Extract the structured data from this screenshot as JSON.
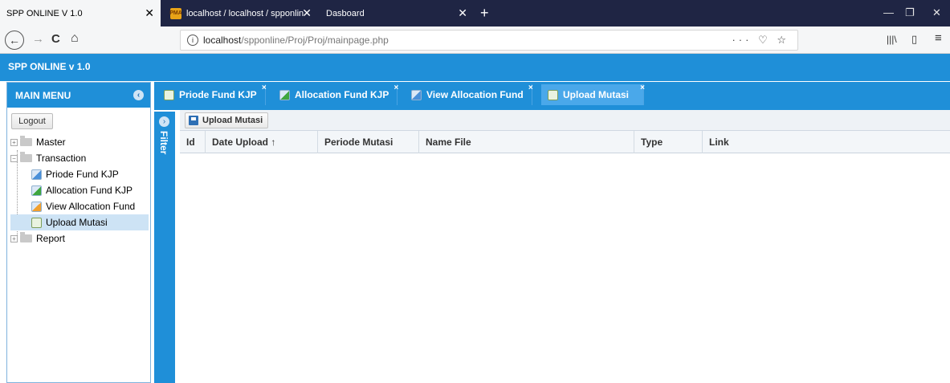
{
  "browser": {
    "tabs": [
      {
        "title": "SPP ONLINE V 1.0",
        "close": "✕"
      },
      {
        "title": "localhost / localhost / spponlin",
        "close": "✕",
        "favicon": "PMA"
      },
      {
        "title": "Dasboard",
        "close": "✕"
      }
    ],
    "new_tab": "+",
    "window_controls": {
      "minimize": "—",
      "restore": "❐",
      "close": "✕"
    }
  },
  "navbar": {
    "back": "←",
    "forward": "→",
    "reload": "C",
    "home": "⌂",
    "url_info": "i",
    "url_host": "localhost",
    "url_path": "/spponline/Proj/Proj/mainpage.php",
    "url_actions": "··· ♡ ☆",
    "library": "|||\\",
    "sidebar_toggle": "▯",
    "menu": "≡"
  },
  "app": {
    "title": "SPP ONLINE v 1.0"
  },
  "sidebar": {
    "title": "MAIN MENU",
    "logout": "Logout",
    "tree": [
      {
        "label": "Master",
        "type": "folder",
        "expander": "+"
      },
      {
        "label": "Transaction",
        "type": "folder",
        "expander": "−"
      },
      {
        "label": "Priode Fund KJP",
        "type": "leaf",
        "icon": "blue"
      },
      {
        "label": "Allocation Fund KJP",
        "type": "leaf",
        "icon": "green"
      },
      {
        "label": "View Allocation Fund",
        "type": "leaf",
        "icon": "orange"
      },
      {
        "label": "Upload Mutasi",
        "type": "leaf",
        "icon": "sheet",
        "selected": true
      },
      {
        "label": "Report",
        "type": "folder",
        "expander": "+"
      }
    ]
  },
  "filter": {
    "label": "Filter",
    "expand": "›"
  },
  "tabs": [
    {
      "label": "Priode Fund KJP",
      "close": "×"
    },
    {
      "label": "Allocation Fund KJP",
      "close": "×"
    },
    {
      "label": "View Allocation Fund",
      "close": "×"
    },
    {
      "label": "Upload Mutasi",
      "close": "×",
      "active": true
    }
  ],
  "toolbar": {
    "upload_label": "Upload Mutasi"
  },
  "grid": {
    "columns": [
      "Id",
      "Date Upload ↑",
      "Periode Mutasi",
      "Name File",
      "Type",
      "Link"
    ]
  }
}
